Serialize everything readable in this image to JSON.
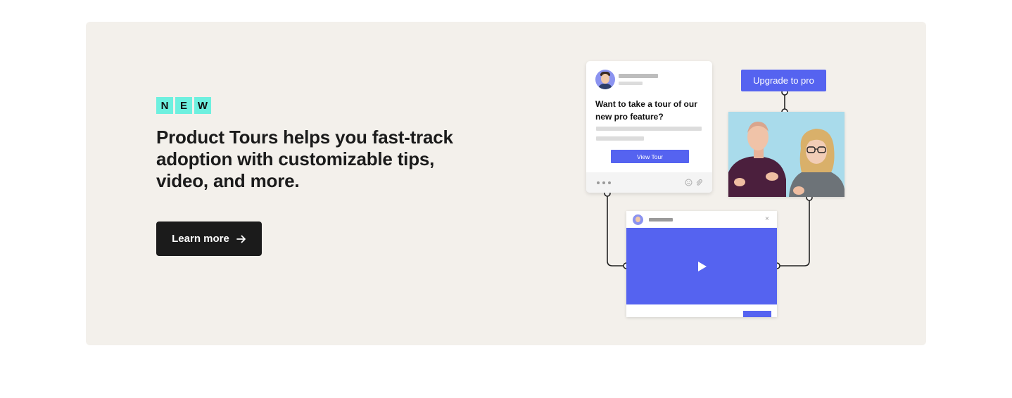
{
  "banner": {
    "badge_letters": [
      "N",
      "E",
      "W"
    ],
    "headline": "Product Tours helps you fast-track adoption with customizable tips, video, and more.",
    "cta_label": "Learn more",
    "cta_icon": "arrow-right-icon"
  },
  "illustration": {
    "tour_card": {
      "question": "Want to take a tour of our new pro feature?",
      "button_label": "View Tour",
      "footer_icons": [
        "more-dots-icon",
        "emoji-icon",
        "attachment-icon"
      ]
    },
    "upgrade_button_label": "Upgrade to pro",
    "player": {
      "close_glyph": "×",
      "play_icon": "play-icon"
    }
  },
  "colors": {
    "banner_bg": "#f3f0eb",
    "badge_bg": "#6ef0df",
    "accent": "#5563f0",
    "cta_bg": "#1b1b1b"
  }
}
